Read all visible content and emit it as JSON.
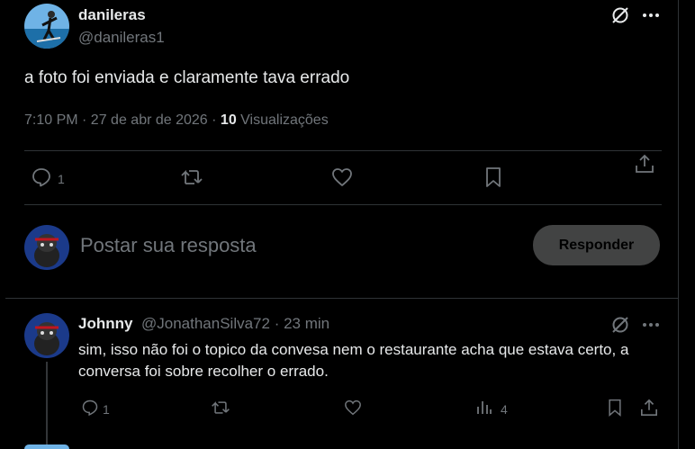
{
  "main_tweet": {
    "display_name": "danileras",
    "handle": "@danileras1",
    "text": "a foto foi enviada e claramente tava errado",
    "time": "7:10 PM · 27 de abr de 2026 · ",
    "views_count": "10",
    "views_label": " Visualizações",
    "reply_count": "1"
  },
  "compose": {
    "placeholder": "Postar sua resposta",
    "button_label": "Responder"
  },
  "reply": {
    "display_name": "Johnny",
    "handle": "@JonathanSilva72 · 23 min",
    "text": "sim, isso não foi o topico da convesa nem o restaurante acha que estava certo, a conversa foi sobre recolher o errado.",
    "reply_count": "1",
    "views_count": "4"
  },
  "colors": {
    "background": "#000000",
    "text": "#e7e9ea",
    "muted": "#71767b",
    "border": "#2f3336"
  }
}
